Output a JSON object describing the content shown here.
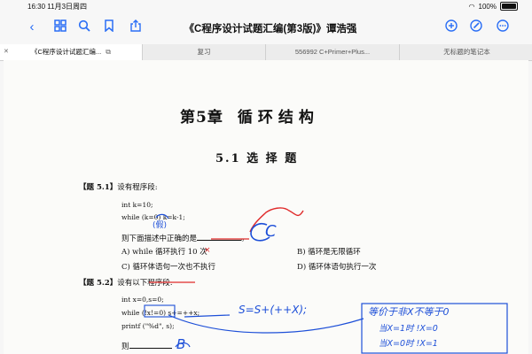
{
  "status_bar": {
    "time": "16:30",
    "date": "11月3日周四",
    "battery": "100%"
  },
  "toolbar": {
    "title": "《C程序设计试题汇编(第3版)》谭浩强"
  },
  "tabs": [
    {
      "label": "《C程序设计试题汇编..."
    },
    {
      "label": "复习"
    },
    {
      "label": "556992 C+Primer+Plus..."
    },
    {
      "label": "无标题的笔记本"
    }
  ],
  "page": {
    "chapter_title": "第5章",
    "chapter_name": "循环结构",
    "section_title": "5.1  选 择 题",
    "q1": {
      "label": "【题 5.1】",
      "stem": "设有程序段:",
      "code": [
        "int k=10;",
        "while (k=0) k=k-1;"
      ],
      "question": "则下面描述中正确的是",
      "options": [
        "A) while 循环执行 10 次",
        "B) 循环是无限循环",
        "C) 循环体语句一次也不执行",
        "D) 循环体语句执行一次"
      ]
    },
    "q2": {
      "label": "【题 5.2】",
      "stem": "设有以下程序段:",
      "code": [
        "int x=0,s=0;",
        "while (!x!=0) s+=++x;",
        "printf (\"%d\", s);"
      ],
      "question": "则"
    }
  },
  "handwriting": {
    "q1_mark": "(假)",
    "q1_answer": "C",
    "q1_option_mark": "×",
    "q2_expr": "S=S+(++X);",
    "q2_note_1": "等价于非X不等于0",
    "q2_note_2": "当X=1时 !X=0",
    "q2_note_3": "当X=0时 !X=1",
    "q2_answer": "B"
  }
}
